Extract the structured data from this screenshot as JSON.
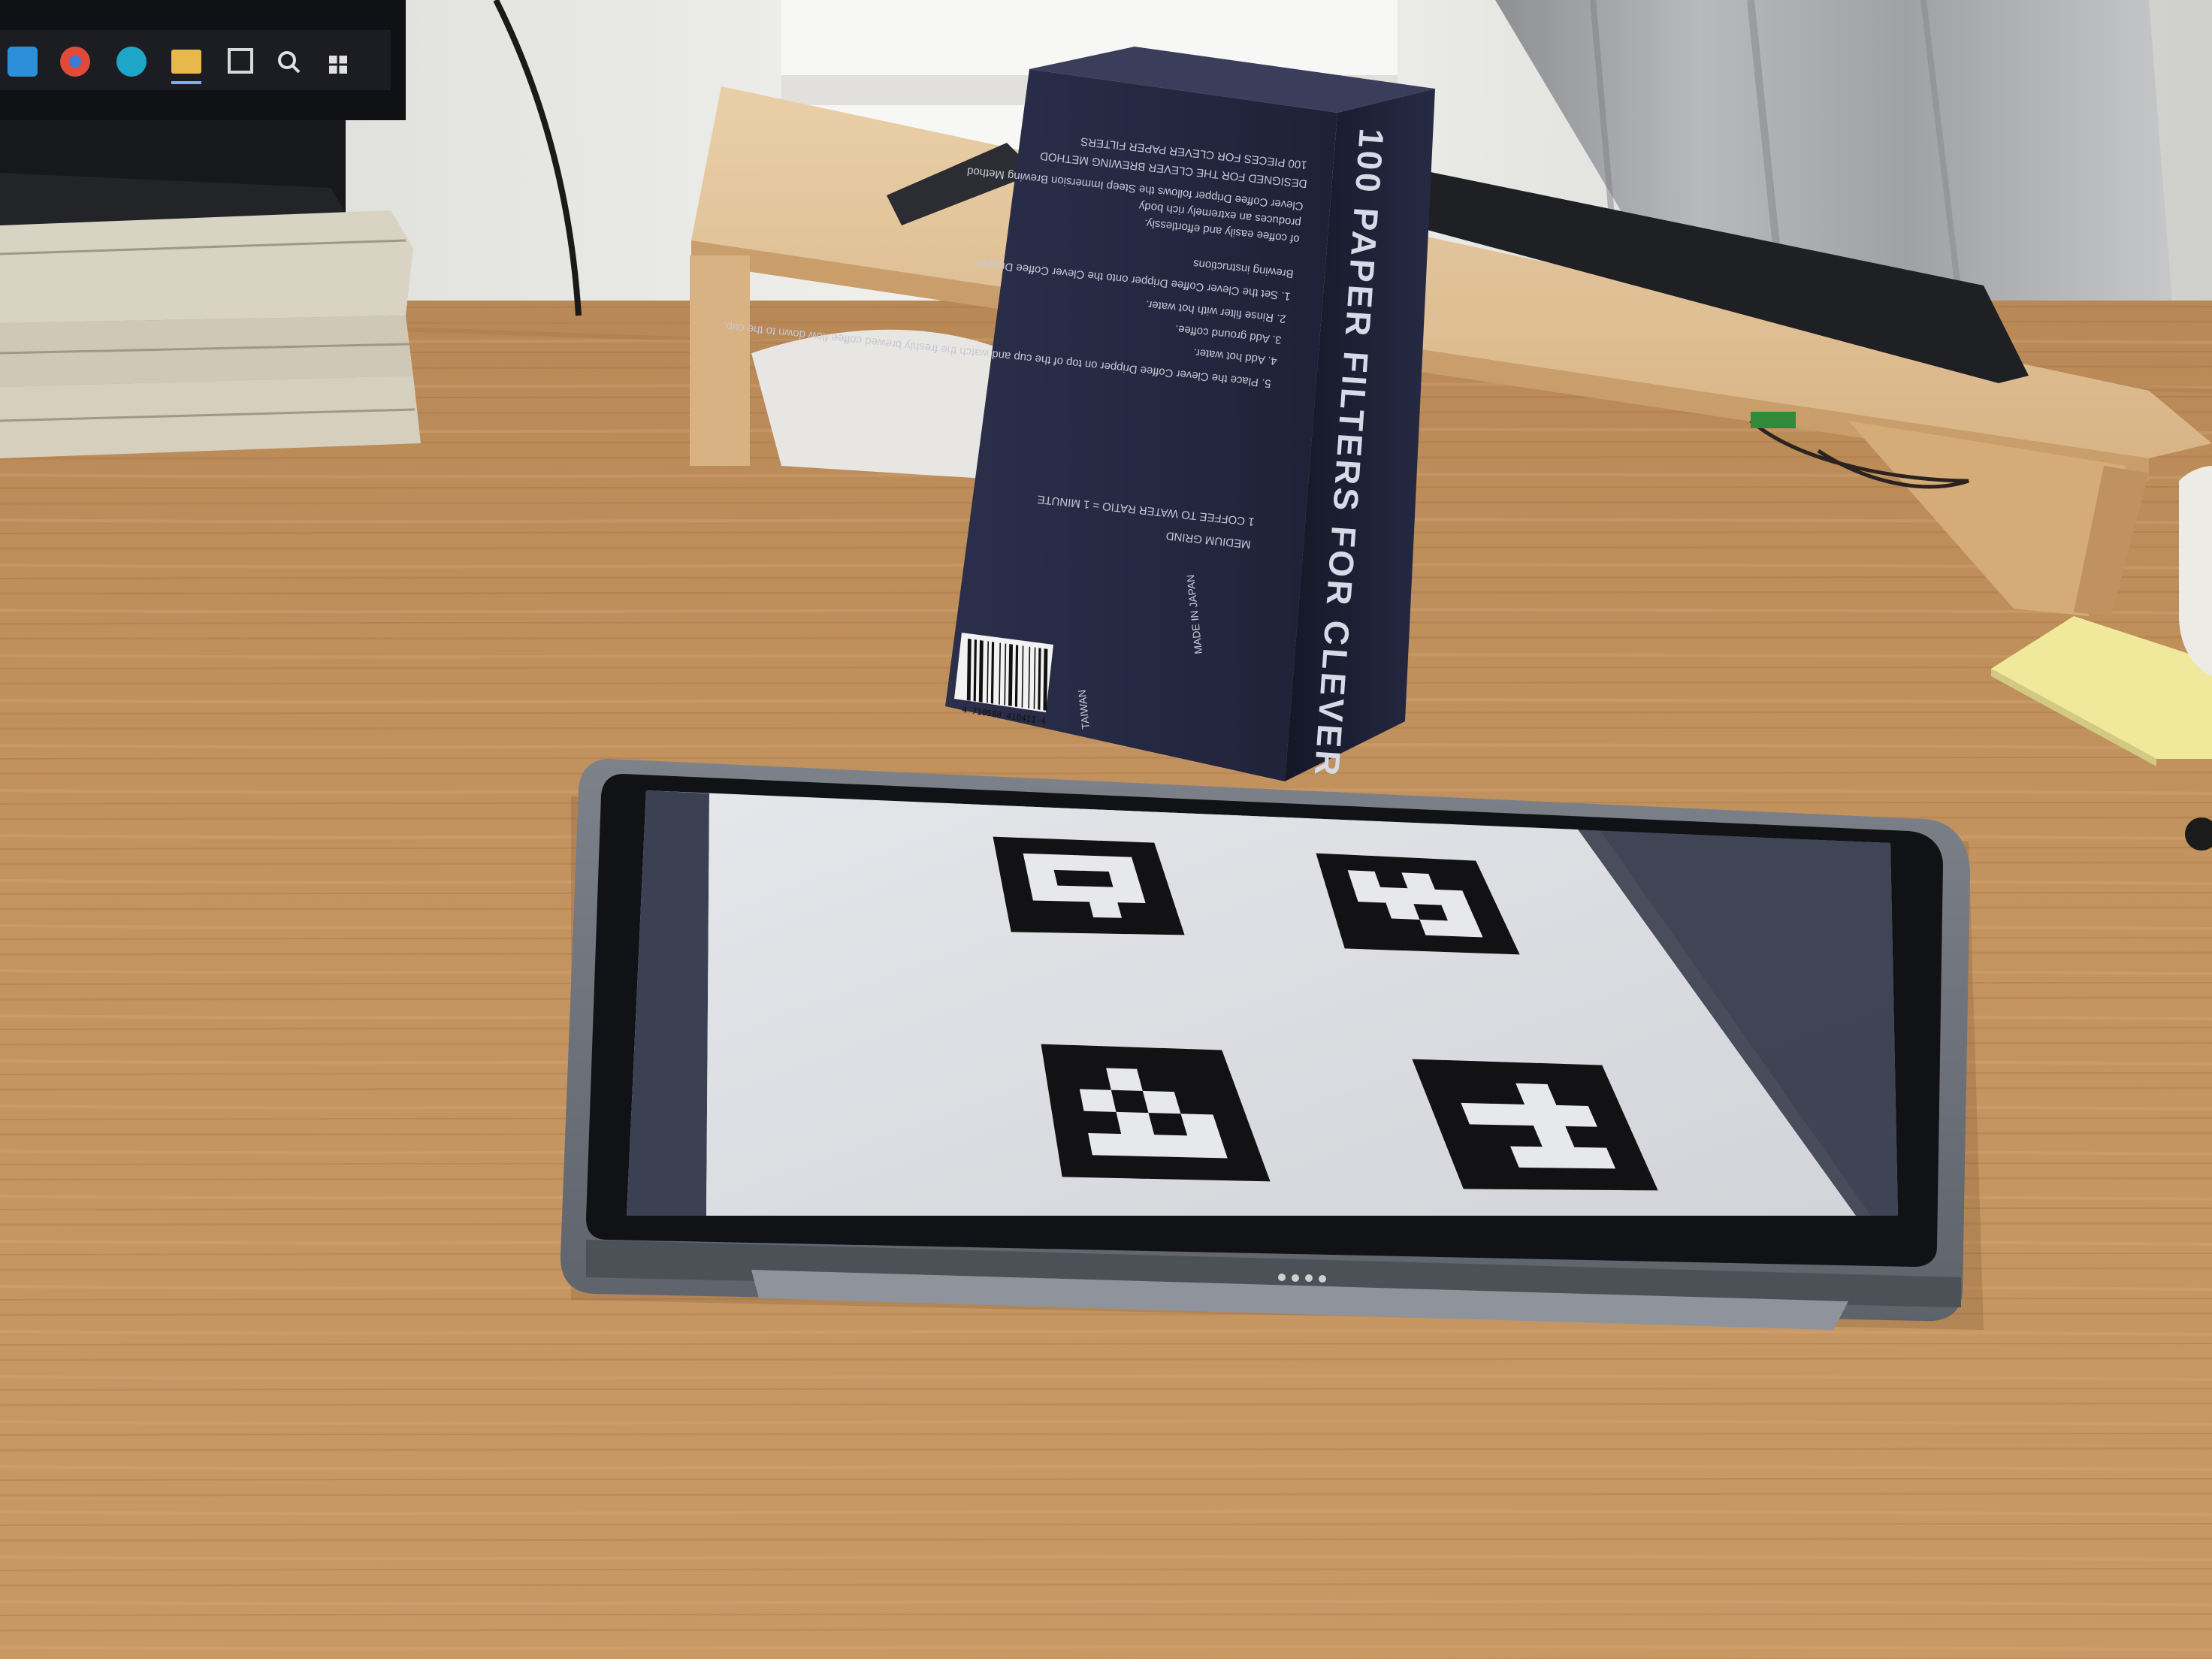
{
  "scene": {
    "description_free": true,
    "colors": {
      "desk": "#c1915f",
      "desk_dark": "#9d6c3e",
      "box": "#1f2238",
      "tablet_frame": "#6f747c",
      "screen_bg": "#d9dbe0",
      "marker": "#121214",
      "wall": "#e9e9e6"
    }
  },
  "taskbar": {
    "icons": [
      "vscode-icon",
      "chrome-icon",
      "edge-icon",
      "files-icon",
      "media-icon",
      "search-icon",
      "windows-icon"
    ]
  },
  "box": {
    "title_line1": "100 PAPER FILTERS FOR CLEVER",
    "made_in": "MADE IN JAPAN",
    "origin": "TAIWAN",
    "barcode_digits": "4 710588 410411 4",
    "front_lines": [
      "100 PIECES FOR CLEVER PAPER FILTERS",
      "DESIGNED FOR THE CLEVER BREWING METHOD",
      "Clever Coffee Dripper follows the Steep Immersion Brewing Method",
      "produces an extremely rich body",
      "of coffee easily and effortlessly.",
      "Brewing instructions",
      "1. Set the Clever Coffee Dripper onto the Clever Coffee Dripper.",
      "2. Rinse filter with hot water.",
      "3. Add ground coffee.",
      "4. Add hot water.",
      "5. Place the Clever Coffee Dripper on top of the cup and watch the freshly brewed coffee flow down to the cup.",
      "1 COFFEE TO WATER RATIO = 1 MINUTE",
      "MEDIUM GRIND"
    ]
  },
  "tablet": {
    "markers": [
      {
        "id": "marker-top-left"
      },
      {
        "id": "marker-top-right"
      },
      {
        "id": "marker-bottom-left"
      },
      {
        "id": "marker-bottom-right"
      }
    ]
  }
}
